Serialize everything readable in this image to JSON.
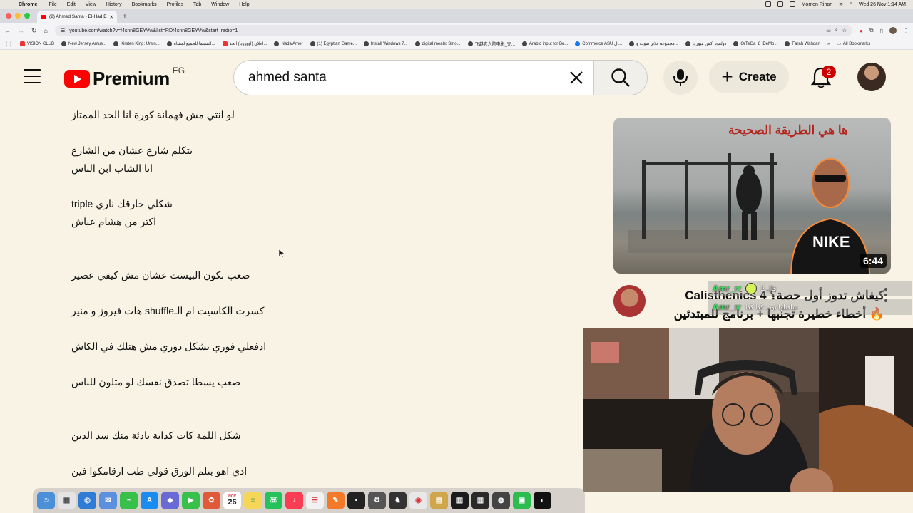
{
  "menubar": {
    "app_name": "Chrome",
    "items": [
      "File",
      "Edit",
      "View",
      "History",
      "Bookmarks",
      "Profiles",
      "Tab",
      "Window",
      "Help"
    ],
    "user": "Momen Rihan",
    "datetime": "Wed 26 Nov 1:14 AM"
  },
  "browser": {
    "tab_title": "(2) Ahmed Santa - El-Had El",
    "url": "youtube.com/watch?v=f4snn8GEYVw&list=RDf4snn8GEYVw&start_radio=1",
    "bookmarks": [
      "VISION CLUB",
      "New Jersey Amus...",
      "Kirsten King: Ursin...",
      "السينما للجميع لمشاه...",
      "اعلان (اووووبا) الجد...",
      "Nada Amer",
      "(1) Egyptian Game...",
      "Install Windows 7...",
      "digital.meals: Smo...",
      "飞越老人院电影_完...",
      "Arabic input for Bo...",
      "Commerce ASU ال...",
      "مجموعة فلاتر صوت و...",
      "دولفود اكس ميوزك",
      "OrTeGa_8_DeMo...",
      "Farah Wahdan"
    ],
    "all_bookmarks": "All Bookmarks"
  },
  "youtube": {
    "logo_text": "Premium",
    "country": "EG",
    "search_value": "ahmed santa",
    "create_label": "Create",
    "notification_count": "2"
  },
  "lyrics": [
    "لو انتي مش فهمانة كورة انا الحد الممتاز",
    "بتكلم شارع عشان من الشارع",
    "انا الشاب ابن الناس",
    "شكلي حارقك ناري triple",
    "اكتر من هشام عباش",
    "صعب تكون البيست عشان مش كيفي عصير",
    "كسرت الكاسيت ام الـshuffle هات فيروز و منير",
    "ادفعلي فوري بشكل دوري مش هنلك في الكاش",
    "صعب يسطا تصدق نفسك لو متلون للناس",
    "شكل اللمة كات كداية بادئة منك سد الدين",
    "ادي اهو بنلم الورق قولي طب ارقامكوا فين"
  ],
  "video": {
    "overlay_text": "ها هي الطريقة الصحيحة",
    "duration": "6:44",
    "title": "Calisthenics كيفاش تدوز أول حصة؟ 4 أخطاء خطيرة تجنبها + برنامج للمبتدئين 🔥",
    "chat": [
      {
        "name": "Amr_rr",
        "msg": "قال 2"
      },
      {
        "name": "Amr_rr",
        "msg": "سافتلها توب كدا كدا"
      }
    ]
  },
  "dock": {
    "calendar_month": "NOV",
    "calendar_day": "26"
  },
  "colors": {
    "page_bg": "#f8f3e4",
    "yt_red": "#ff0000",
    "badge_red": "#cc0000",
    "overlay_red": "#b3251d"
  }
}
